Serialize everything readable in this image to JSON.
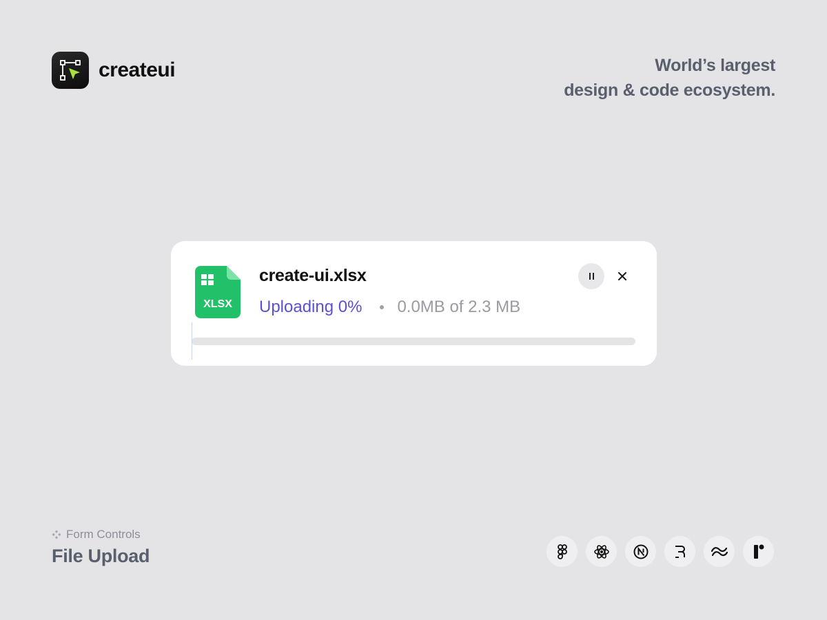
{
  "brand": {
    "name": "createui",
    "logo_icon": "vector-select-cursor-icon",
    "accent": "#a6e23a"
  },
  "tagline": {
    "line1": "World’s largest",
    "line2": "design & code ecosystem."
  },
  "upload": {
    "file_type_label": "XLSX",
    "file_icon": "spreadsheet-file-icon",
    "file_icon_color": "#22c068",
    "file_name": "create-ui.xlsx",
    "status": "Uploading 0%",
    "size_text": "0.0MB of 2.3 MB",
    "progress_percent": 0,
    "accent": "#5b50d6",
    "pause_icon": "pause-icon",
    "close_icon": "close-icon"
  },
  "footer": {
    "category": "Form Controls",
    "category_icon": "component-diamond-icon",
    "title": "File Upload",
    "tech_icons": [
      "figma-icon",
      "react-icon",
      "nextjs-icon",
      "remix-icon",
      "tailwind-icon",
      "framer-icon"
    ]
  }
}
